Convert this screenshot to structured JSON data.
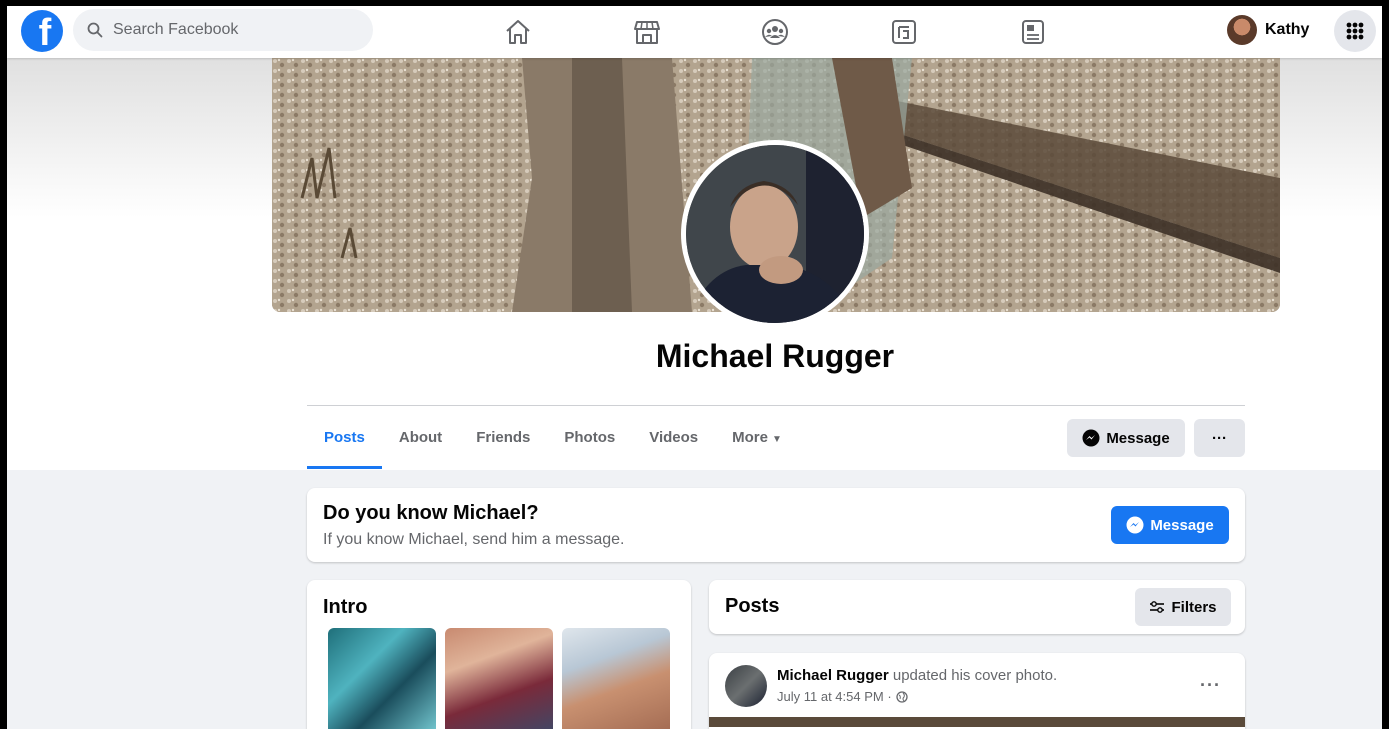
{
  "topnav": {
    "logo_letter": "f",
    "search_placeholder": "Search Facebook",
    "nav_icons": [
      "home-icon",
      "marketplace-icon",
      "groups-icon",
      "gaming-icon",
      "news-icon"
    ],
    "user_name": "Kathy",
    "menu_icon": "grid-menu-icon"
  },
  "profile": {
    "name": "Michael Rugger",
    "tabs": [
      {
        "label": "Posts",
        "active": true
      },
      {
        "label": "About"
      },
      {
        "label": "Friends"
      },
      {
        "label": "Photos"
      },
      {
        "label": "Videos"
      },
      {
        "label": "More",
        "has_caret": true
      }
    ],
    "message_button": "Message",
    "more_button": "···"
  },
  "know_card": {
    "title": "Do you know Michael?",
    "subtitle": "If you know Michael, send him a message.",
    "button": "Message"
  },
  "intro": {
    "title": "Intro"
  },
  "posts": {
    "title": "Posts",
    "filters_button": "Filters",
    "items": [
      {
        "author": "Michael Rugger",
        "action": "updated his cover photo.",
        "time": "July 11 at 4:54 PM ·",
        "privacy_icon": "globe-icon",
        "more": "···"
      }
    ]
  },
  "colors": {
    "brand": "#1877f2",
    "background": "#f0f2f5",
    "secondary_text": "#65676b"
  }
}
